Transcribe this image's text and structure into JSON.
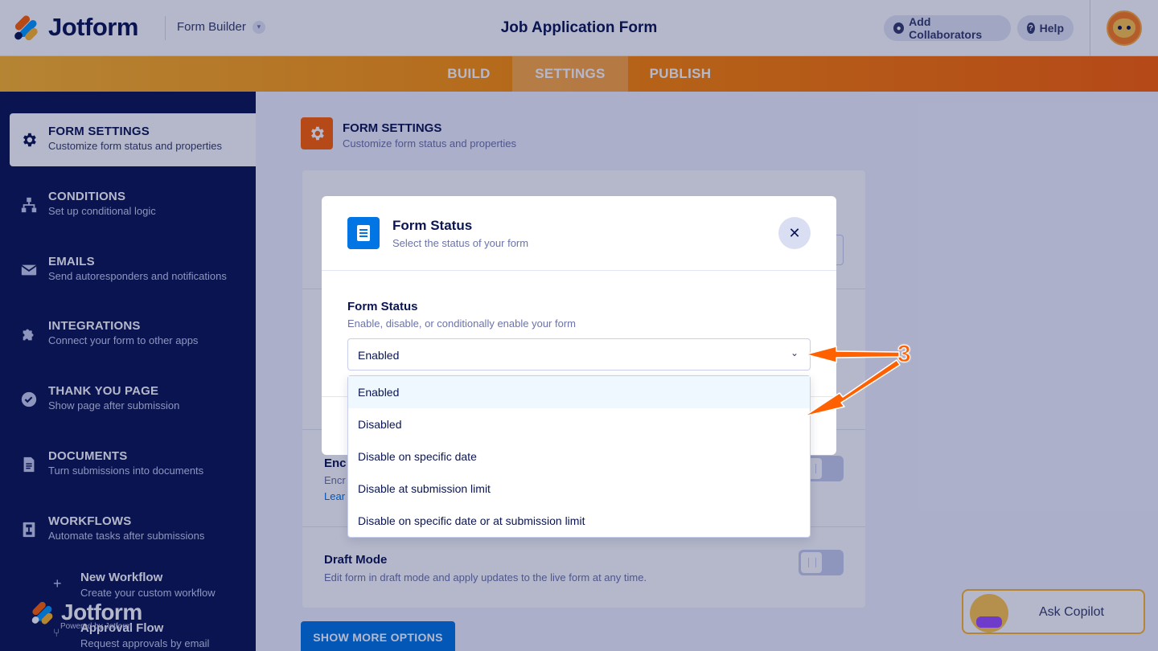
{
  "header": {
    "logo_text": "Jotform",
    "builder_label": "Form Builder",
    "page_title": "Job Application Form",
    "add_collaborators": "Add Collaborators",
    "help": "Help"
  },
  "tabs": [
    {
      "label": "BUILD"
    },
    {
      "label": "SETTINGS",
      "active": true
    },
    {
      "label": "PUBLISH"
    }
  ],
  "sidebar": {
    "items": [
      {
        "title": "FORM SETTINGS",
        "desc": "Customize form status and properties",
        "icon": "gear-icon",
        "active": true
      },
      {
        "title": "CONDITIONS",
        "desc": "Set up conditional logic",
        "icon": "conditions-icon"
      },
      {
        "title": "EMAILS",
        "desc": "Send autoresponders and notifications",
        "icon": "mail-icon"
      },
      {
        "title": "INTEGRATIONS",
        "desc": "Connect your form to other apps",
        "icon": "puzzle-icon"
      },
      {
        "title": "THANK YOU PAGE",
        "desc": "Show page after submission",
        "icon": "check-circle-icon"
      },
      {
        "title": "DOCUMENTS",
        "desc": "Turn submissions into documents",
        "icon": "document-icon"
      },
      {
        "title": "WORKFLOWS",
        "desc": "Automate tasks after submissions",
        "icon": "workflow-icon"
      }
    ],
    "sub_items": [
      {
        "title": "New Workflow",
        "desc": "Create your custom workflow",
        "icon": "plus-icon"
      },
      {
        "title": "Approval Flow",
        "desc": "Request approvals by email",
        "icon": "flow-icon"
      }
    ],
    "footer_logo": "Jotform",
    "powered_by": "Powered by Jotform"
  },
  "main": {
    "section_title": "FORM SETTINGS",
    "section_desc": "Customize form status and properties",
    "rows": [
      {
        "title": "Enc",
        "desc": "Encr",
        "link": "Lear"
      },
      {
        "title": "Draft Mode",
        "desc": "Edit form in draft mode and apply updates to the live form at any time."
      }
    ],
    "show_more": "SHOW MORE OPTIONS",
    "copilot": "Ask Copilot"
  },
  "modal": {
    "title": "Form Status",
    "subtitle": "Select the status of your form",
    "field_label": "Form Status",
    "field_desc": "Enable, disable, or conditionally enable your form",
    "selected": "Enabled",
    "options": [
      "Enabled",
      "Disabled",
      "Disable on specific date",
      "Disable at submission limit",
      "Disable on specific date or at submission limit"
    ]
  },
  "annotation": {
    "step": "3",
    "color": "#ff6100"
  },
  "colors": {
    "navy": "#0a1551",
    "orange": "#ff6100",
    "blue": "#0075e3"
  }
}
